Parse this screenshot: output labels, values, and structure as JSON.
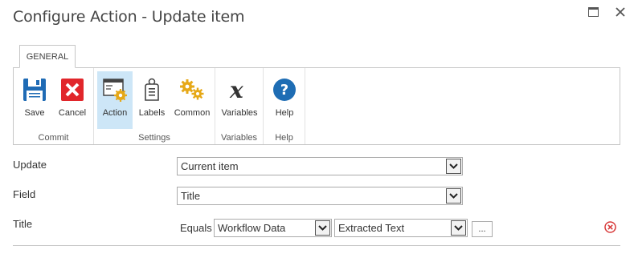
{
  "dialog": {
    "title": "Configure Action - Update item"
  },
  "ribbon": {
    "tab": "GENERAL",
    "groups": [
      {
        "label": "Commit",
        "buttons": [
          {
            "label": "Save",
            "icon": "save-icon"
          },
          {
            "label": "Cancel",
            "icon": "cancel-icon"
          }
        ]
      },
      {
        "label": "Settings",
        "buttons": [
          {
            "label": "Action",
            "icon": "action-icon",
            "active": true
          },
          {
            "label": "Labels",
            "icon": "labels-icon"
          },
          {
            "label": "Common",
            "icon": "common-gears-icon"
          }
        ]
      },
      {
        "label": "Variables",
        "buttons": [
          {
            "label": "Variables",
            "icon": "variables-icon"
          }
        ]
      },
      {
        "label": "Help",
        "buttons": [
          {
            "label": "Help",
            "icon": "help-icon"
          }
        ]
      }
    ]
  },
  "form": {
    "update": {
      "label": "Update",
      "value": "Current item"
    },
    "field": {
      "label": "Field",
      "value": "Title"
    },
    "title_row": {
      "label": "Title",
      "operator": "Equals",
      "source": "Workflow Data",
      "value": "Extracted Text",
      "more_button": "..."
    }
  },
  "colors": {
    "save_blue": "#1f6bb5",
    "cancel_red": "#e1262b",
    "help_blue": "#1e6db4",
    "gear_gold": "#e6a817",
    "active_highlight": "#cde6f7",
    "remove_red": "#d83b3b"
  }
}
